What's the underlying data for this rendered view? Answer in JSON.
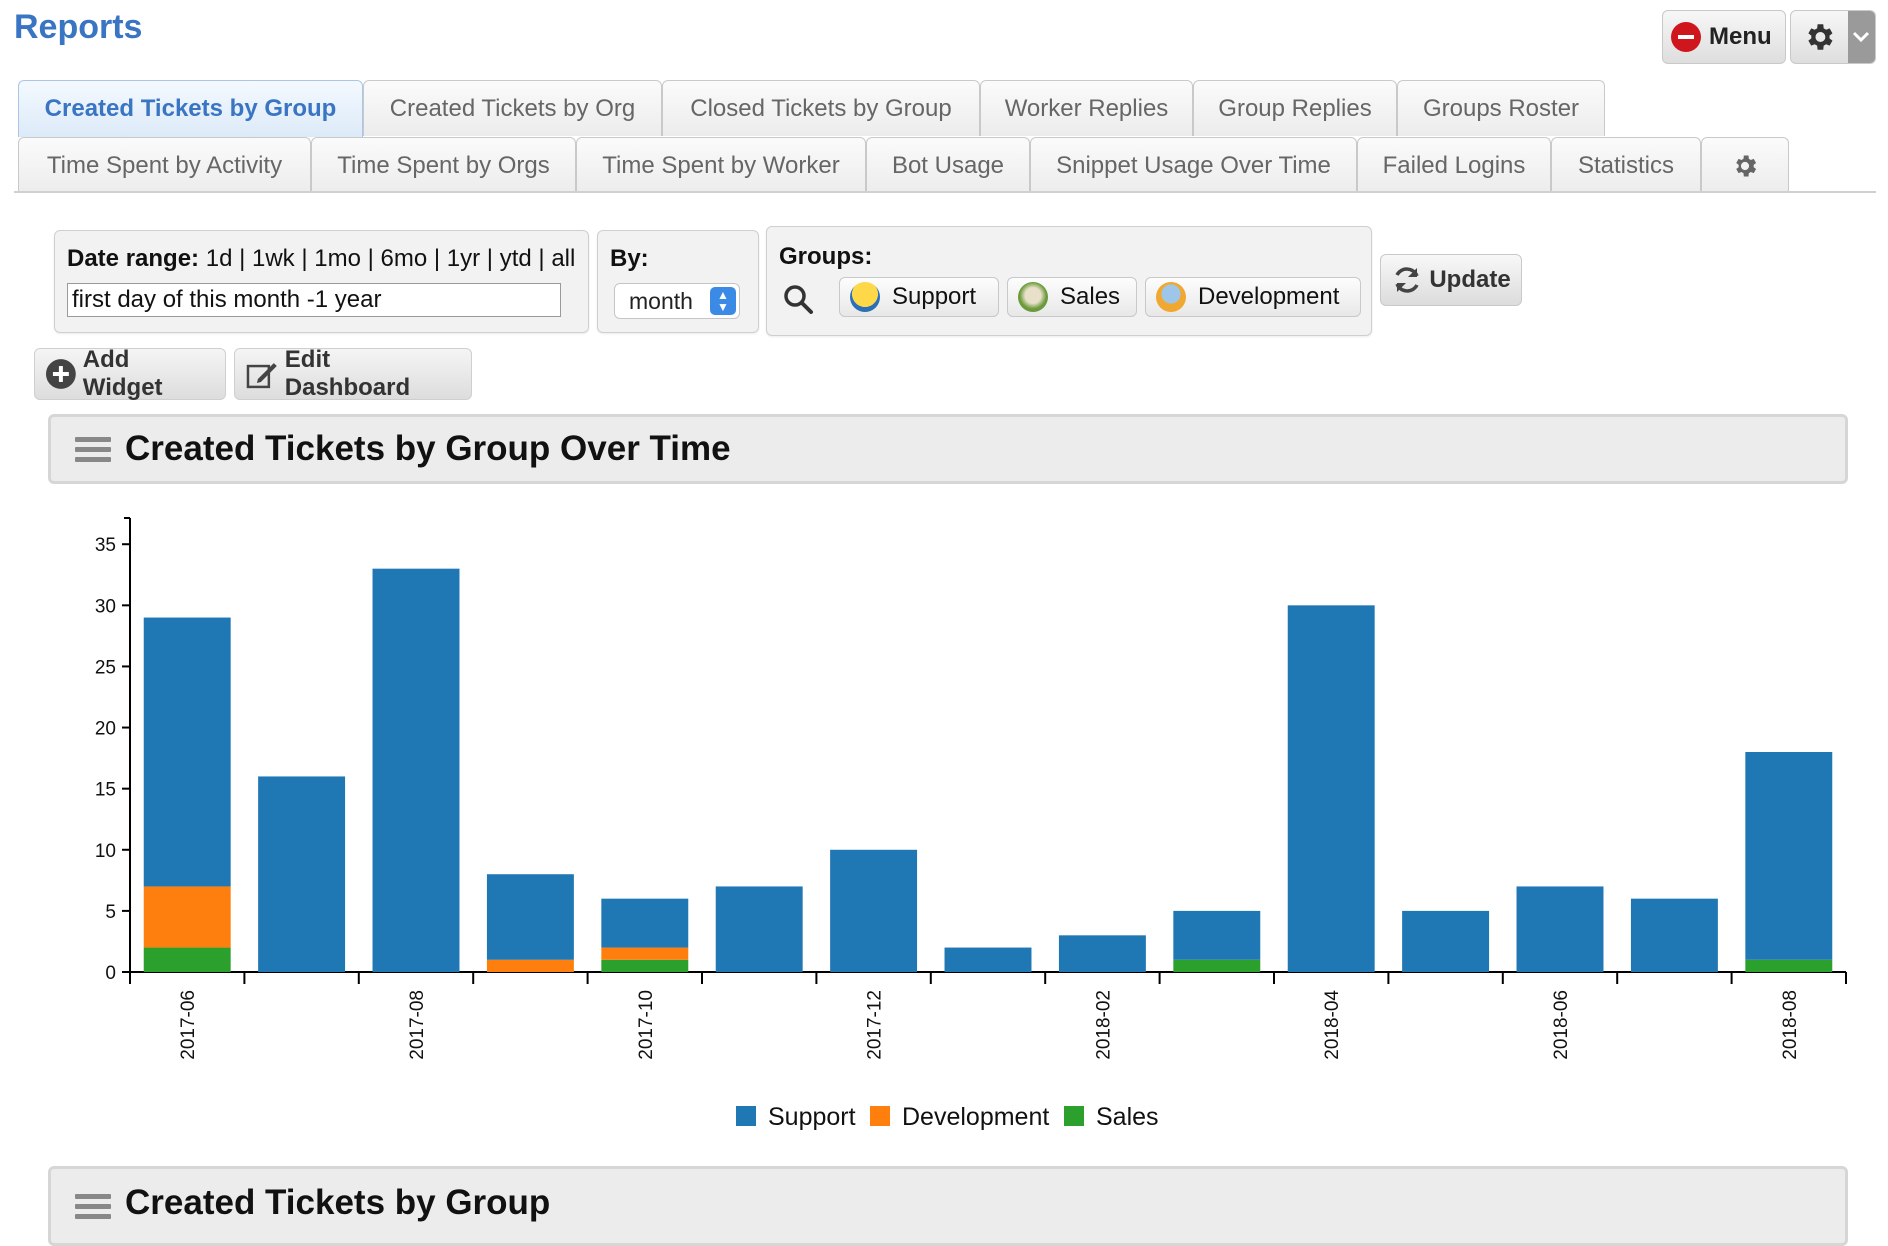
{
  "header": {
    "title": "Reports",
    "menu_label": "Menu"
  },
  "tabs": {
    "row1": [
      "Created Tickets by Group",
      "Created Tickets by Org",
      "Closed Tickets by Group",
      "Worker Replies",
      "Group Replies",
      "Groups Roster"
    ],
    "row2": [
      "Time Spent by Activity",
      "Time Spent by Orgs",
      "Time Spent by Worker",
      "Bot Usage",
      "Snippet Usage Over Time",
      "Failed Logins",
      "Statistics"
    ],
    "active": "Created Tickets by Group"
  },
  "filters": {
    "date_range_label": "Date range:",
    "range_links": [
      "1d",
      "1wk",
      "1mo",
      "6mo",
      "1yr",
      "ytd",
      "all"
    ],
    "date_value": "first day of this month -1 year",
    "by_label": "By:",
    "by_value": "month",
    "groups_label": "Groups:",
    "groups": [
      "Support",
      "Sales",
      "Development"
    ],
    "update_label": "Update"
  },
  "dashboard": {
    "add_widget_label": "Add Widget",
    "edit_dashboard_label": "Edit Dashboard"
  },
  "widgets": [
    {
      "title": "Created Tickets by Group Over Time"
    },
    {
      "title": "Created Tickets by Group"
    }
  ],
  "colors": {
    "Support": "#1f77b4",
    "Development": "#ff7f0e",
    "Sales": "#2ca02c",
    "title_blue": "#3a75c4"
  },
  "chart_data": {
    "type": "bar",
    "stacked": true,
    "categories": [
      "2017-06",
      "2017-07",
      "2017-08",
      "2017-09",
      "2017-10",
      "2017-11",
      "2017-12",
      "2018-01",
      "2018-02",
      "2018-03",
      "2018-04",
      "2018-05",
      "2018-06",
      "2018-07",
      "2018-08"
    ],
    "x_tick_labels": [
      "2017-06",
      "2017-08",
      "2017-10",
      "2017-12",
      "2018-02",
      "2018-04",
      "2018-06",
      "2018-08"
    ],
    "series": [
      {
        "name": "Sales",
        "values": [
          2,
          0,
          0,
          0,
          1,
          0,
          0,
          0,
          0,
          1,
          0,
          0,
          0,
          0,
          1
        ]
      },
      {
        "name": "Development",
        "values": [
          5,
          0,
          0,
          1,
          1,
          0,
          0,
          0,
          0,
          0,
          0,
          0,
          0,
          0,
          0
        ]
      },
      {
        "name": "Support",
        "values": [
          22,
          16,
          33,
          7,
          4,
          7,
          10,
          2,
          3,
          4,
          30,
          5,
          7,
          6,
          17
        ]
      }
    ],
    "legend": [
      "Support",
      "Development",
      "Sales"
    ],
    "legend_position": "bottom",
    "y_ticks": [
      0,
      5,
      10,
      15,
      20,
      25,
      30,
      35
    ],
    "ylim": [
      0,
      36
    ],
    "grid": false
  }
}
